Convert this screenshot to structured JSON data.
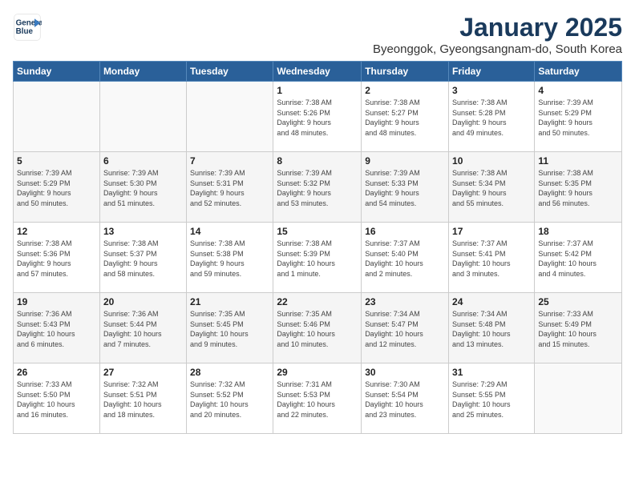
{
  "header": {
    "logo_line1": "General",
    "logo_line2": "Blue",
    "title": "January 2025",
    "subtitle": "Byeonggok, Gyeongsangnam-do, South Korea"
  },
  "weekdays": [
    "Sunday",
    "Monday",
    "Tuesday",
    "Wednesday",
    "Thursday",
    "Friday",
    "Saturday"
  ],
  "weeks": [
    [
      {
        "day": "",
        "info": ""
      },
      {
        "day": "",
        "info": ""
      },
      {
        "day": "",
        "info": ""
      },
      {
        "day": "1",
        "info": "Sunrise: 7:38 AM\nSunset: 5:26 PM\nDaylight: 9 hours\nand 48 minutes."
      },
      {
        "day": "2",
        "info": "Sunrise: 7:38 AM\nSunset: 5:27 PM\nDaylight: 9 hours\nand 48 minutes."
      },
      {
        "day": "3",
        "info": "Sunrise: 7:38 AM\nSunset: 5:28 PM\nDaylight: 9 hours\nand 49 minutes."
      },
      {
        "day": "4",
        "info": "Sunrise: 7:39 AM\nSunset: 5:29 PM\nDaylight: 9 hours\nand 50 minutes."
      }
    ],
    [
      {
        "day": "5",
        "info": "Sunrise: 7:39 AM\nSunset: 5:29 PM\nDaylight: 9 hours\nand 50 minutes."
      },
      {
        "day": "6",
        "info": "Sunrise: 7:39 AM\nSunset: 5:30 PM\nDaylight: 9 hours\nand 51 minutes."
      },
      {
        "day": "7",
        "info": "Sunrise: 7:39 AM\nSunset: 5:31 PM\nDaylight: 9 hours\nand 52 minutes."
      },
      {
        "day": "8",
        "info": "Sunrise: 7:39 AM\nSunset: 5:32 PM\nDaylight: 9 hours\nand 53 minutes."
      },
      {
        "day": "9",
        "info": "Sunrise: 7:39 AM\nSunset: 5:33 PM\nDaylight: 9 hours\nand 54 minutes."
      },
      {
        "day": "10",
        "info": "Sunrise: 7:38 AM\nSunset: 5:34 PM\nDaylight: 9 hours\nand 55 minutes."
      },
      {
        "day": "11",
        "info": "Sunrise: 7:38 AM\nSunset: 5:35 PM\nDaylight: 9 hours\nand 56 minutes."
      }
    ],
    [
      {
        "day": "12",
        "info": "Sunrise: 7:38 AM\nSunset: 5:36 PM\nDaylight: 9 hours\nand 57 minutes."
      },
      {
        "day": "13",
        "info": "Sunrise: 7:38 AM\nSunset: 5:37 PM\nDaylight: 9 hours\nand 58 minutes."
      },
      {
        "day": "14",
        "info": "Sunrise: 7:38 AM\nSunset: 5:38 PM\nDaylight: 9 hours\nand 59 minutes."
      },
      {
        "day": "15",
        "info": "Sunrise: 7:38 AM\nSunset: 5:39 PM\nDaylight: 10 hours\nand 1 minute."
      },
      {
        "day": "16",
        "info": "Sunrise: 7:37 AM\nSunset: 5:40 PM\nDaylight: 10 hours\nand 2 minutes."
      },
      {
        "day": "17",
        "info": "Sunrise: 7:37 AM\nSunset: 5:41 PM\nDaylight: 10 hours\nand 3 minutes."
      },
      {
        "day": "18",
        "info": "Sunrise: 7:37 AM\nSunset: 5:42 PM\nDaylight: 10 hours\nand 4 minutes."
      }
    ],
    [
      {
        "day": "19",
        "info": "Sunrise: 7:36 AM\nSunset: 5:43 PM\nDaylight: 10 hours\nand 6 minutes."
      },
      {
        "day": "20",
        "info": "Sunrise: 7:36 AM\nSunset: 5:44 PM\nDaylight: 10 hours\nand 7 minutes."
      },
      {
        "day": "21",
        "info": "Sunrise: 7:35 AM\nSunset: 5:45 PM\nDaylight: 10 hours\nand 9 minutes."
      },
      {
        "day": "22",
        "info": "Sunrise: 7:35 AM\nSunset: 5:46 PM\nDaylight: 10 hours\nand 10 minutes."
      },
      {
        "day": "23",
        "info": "Sunrise: 7:34 AM\nSunset: 5:47 PM\nDaylight: 10 hours\nand 12 minutes."
      },
      {
        "day": "24",
        "info": "Sunrise: 7:34 AM\nSunset: 5:48 PM\nDaylight: 10 hours\nand 13 minutes."
      },
      {
        "day": "25",
        "info": "Sunrise: 7:33 AM\nSunset: 5:49 PM\nDaylight: 10 hours\nand 15 minutes."
      }
    ],
    [
      {
        "day": "26",
        "info": "Sunrise: 7:33 AM\nSunset: 5:50 PM\nDaylight: 10 hours\nand 16 minutes."
      },
      {
        "day": "27",
        "info": "Sunrise: 7:32 AM\nSunset: 5:51 PM\nDaylight: 10 hours\nand 18 minutes."
      },
      {
        "day": "28",
        "info": "Sunrise: 7:32 AM\nSunset: 5:52 PM\nDaylight: 10 hours\nand 20 minutes."
      },
      {
        "day": "29",
        "info": "Sunrise: 7:31 AM\nSunset: 5:53 PM\nDaylight: 10 hours\nand 22 minutes."
      },
      {
        "day": "30",
        "info": "Sunrise: 7:30 AM\nSunset: 5:54 PM\nDaylight: 10 hours\nand 23 minutes."
      },
      {
        "day": "31",
        "info": "Sunrise: 7:29 AM\nSunset: 5:55 PM\nDaylight: 10 hours\nand 25 minutes."
      },
      {
        "day": "",
        "info": ""
      }
    ]
  ]
}
